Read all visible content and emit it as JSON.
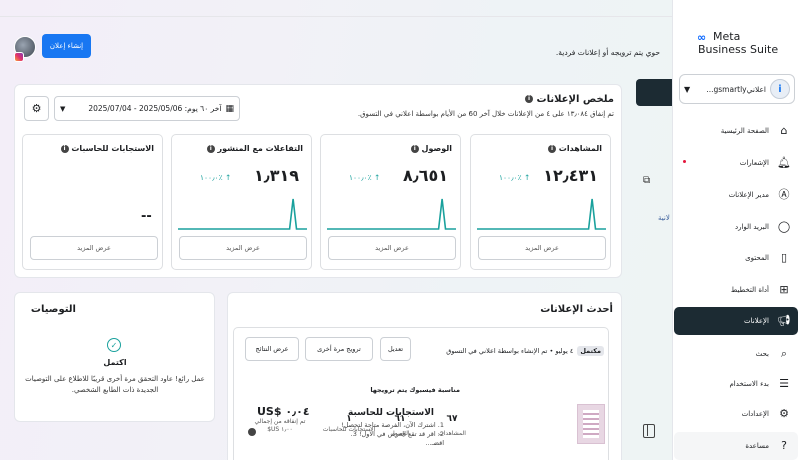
{
  "sidebar": {
    "brand_title": "Meta",
    "brand_subtitle": "Business Suite",
    "account_name": "اعلانيgsmartly...",
    "items": [
      {
        "label": "الصفحة الرئيسية",
        "icon": "home-icon"
      },
      {
        "label": "الإشعارات",
        "icon": "bell-icon"
      },
      {
        "label": "مدير الإعلانات",
        "icon": "ads-manager-icon"
      },
      {
        "label": "البريد الوارد",
        "icon": "inbox-icon"
      },
      {
        "label": "المحتوى",
        "icon": "content-icon"
      },
      {
        "label": "أداة التخطيط",
        "icon": "planner-icon"
      },
      {
        "label": "الإعلانات",
        "icon": "megaphone-icon",
        "active": true
      },
      {
        "label": "بحث",
        "icon": "search-icon"
      },
      {
        "label": "بدء الاستخدام",
        "icon": "list-icon"
      },
      {
        "label": "الإعدادات",
        "icon": "gear-icon"
      },
      {
        "label": "مساعدة",
        "icon": "help-icon"
      }
    ]
  },
  "header": {
    "create_ad_label": "إنشاء إعلان",
    "intro_text": "حوي يتم ترويجه أو إعلانات فردية."
  },
  "summary": {
    "title": "ملخص الإعلانات",
    "subtitle": "تم إنفاق ١٣٫٠٨٤ على ٤ من الإعلانات خلال آخر 60 من الأيام بواسطة اعلاني في التسوق.",
    "date_range": "آخر ٦٠ يوم: 2025/05/06 - 2025/07/04",
    "metrics": [
      {
        "title": "المشاهدات",
        "value": "١٢٫٤٣١",
        "change": "١٠٠٫٠٪ ↑",
        "more": "عرض المزيد",
        "spark": [
          0,
          0,
          0,
          0,
          0,
          0,
          0,
          0,
          0,
          0,
          0,
          0,
          0,
          0,
          0,
          0,
          0,
          0,
          0,
          0,
          0,
          0,
          0,
          0,
          0,
          0,
          0,
          0,
          0,
          0,
          0,
          0,
          0,
          1,
          0,
          0,
          0,
          0
        ]
      },
      {
        "title": "الوصول",
        "value": "٨٫٦٥١",
        "change": "١٠٠٫٠٪ ↑",
        "more": "عرض المزيد",
        "spark": [
          0,
          0,
          0,
          0,
          0,
          0,
          0,
          0,
          0,
          0,
          0,
          0,
          0,
          0,
          0,
          0,
          0,
          0,
          0,
          0,
          0,
          0,
          0,
          0,
          0,
          0,
          0,
          0,
          0,
          0,
          0,
          0,
          0,
          1,
          0,
          0,
          0,
          0
        ]
      },
      {
        "title": "التفاعلات مع المنشور",
        "value": "١٫٣١٩",
        "change": "١٠٠٫٠٪ ↑",
        "more": "عرض المزيد",
        "spark": [
          0,
          0,
          0,
          0,
          0,
          0,
          0,
          0,
          0,
          0,
          0,
          0,
          0,
          0,
          0,
          0,
          0,
          0,
          0,
          0,
          0,
          0,
          0,
          0,
          0,
          0,
          0,
          0,
          0,
          0,
          0,
          0,
          0,
          1,
          0,
          0,
          0,
          0
        ]
      },
      {
        "title": "الاستجابات للحاسبات",
        "value": "--",
        "change": "",
        "more": "عرض المزيد",
        "spark": []
      }
    ]
  },
  "recommendations": {
    "title": "التوصيات",
    "status": "اكتمل",
    "description": "عمل رائع! عاود التحقق مرة أخرى قريبًا للاطلاع على التوصيات الجديدة ذات الطابع الشخصي."
  },
  "recent_ads": {
    "title": "أحدث الإعلانات",
    "status_pill": "مكتمل",
    "status_text": "٤ يوليو • تم الإنشاء بواسطة اعلاني في التسوق",
    "buttons": {
      "edit": "تعديل",
      "boost_again": "ترويج مرة أخرى",
      "view_results": "عرض النتائج"
    },
    "ad_tag": "مناسبة فيسبوك يتم ترويجها",
    "ad_title": "الاستجابات للحاسبة",
    "ad_desc": "1. اشترك الآن، الفرصة متاحة لتحصل! 2. اقر قد تقع العرض في الأول! 3. اقضـ...",
    "stats": [
      {
        "value": "٦٧",
        "label": "المشاهدات"
      },
      {
        "value": "٦١",
        "label": "الوصول"
      },
      {
        "value": "١",
        "label": "الاستجابات للحاسبات"
      }
    ],
    "spend_value": "US$ ٠٫٠٤",
    "spend_desc": "تم إنفاقه من إجمالي ١٫٠٠ US$"
  },
  "colors": {
    "accent": "#1877f2",
    "teal": "#1aa19d",
    "dark": "#1c2b33"
  }
}
